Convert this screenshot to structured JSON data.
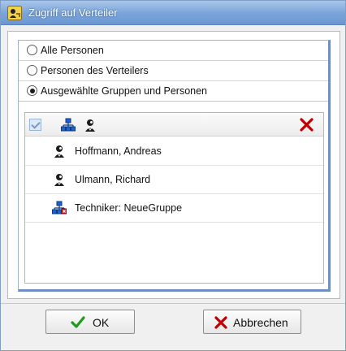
{
  "window": {
    "title": "Zugriff auf Verteiler",
    "icon": "key-user-icon"
  },
  "options": [
    {
      "label": "Alle Personen",
      "selected": false
    },
    {
      "label": "Personen des Verteilers",
      "selected": false
    },
    {
      "label": "Ausgewählte Gruppen und Personen",
      "selected": true
    }
  ],
  "grid": {
    "header_icons": [
      "select-all-checkbox",
      "add-group-icon",
      "add-person-icon",
      "delete-icon"
    ],
    "rows": [
      {
        "label": "Hoffmann, Andreas",
        "icon": "person-icon"
      },
      {
        "label": "Ulmann, Richard",
        "icon": "person-icon"
      },
      {
        "label": "Techniker: NeueGruppe",
        "icon": "group-icon"
      }
    ]
  },
  "buttons": {
    "ok_label": "OK",
    "cancel_label": "Abbrechen"
  },
  "colors": {
    "titlebar": "#7aa3d8",
    "ok_check": "#1e9a1e",
    "delete_red": "#c00000",
    "group_blue": "#2060c8"
  }
}
